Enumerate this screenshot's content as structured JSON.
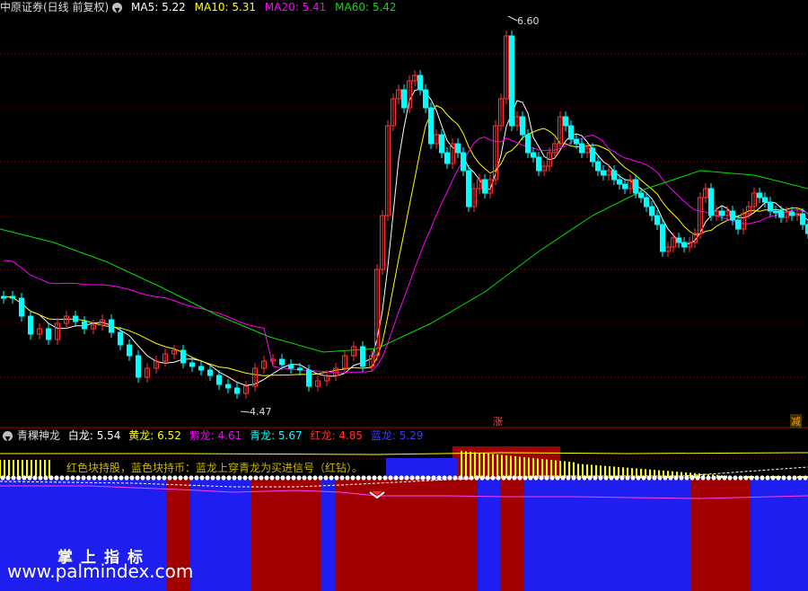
{
  "main_chart": {
    "title": "中原证券(日线 前复权)",
    "indicators": [
      {
        "label": "MA5: 5.22",
        "color": "#ffffff"
      },
      {
        "label": "MA10: 5.31",
        "color": "#ffff00"
      },
      {
        "label": "MA20: 5.41",
        "color": "#ff00ff"
      },
      {
        "label": "MA60: 5.42",
        "color": "#00e000"
      }
    ],
    "high_label": "6.60",
    "low_label": "4.47",
    "markers": {
      "zhang": "涨",
      "jian": "减"
    }
  },
  "sub_chart": {
    "title": "青稞神龙",
    "values": [
      {
        "label": "白龙: 5.54",
        "color": "#ffffff"
      },
      {
        "label": "黄龙: 6.52",
        "color": "#ffff00"
      },
      {
        "label": "紫龙: 4.61",
        "color": "#ff00ff"
      },
      {
        "label": "青龙: 5.67",
        "color": "#00ffff"
      },
      {
        "label": "红龙: 4.85",
        "color": "#ff3030"
      },
      {
        "label": "蓝龙: 5.29",
        "color": "#3a3aff"
      }
    ],
    "note": "红色块持股，蓝色块持币：蓝龙上穿青龙为买进信号（红钻）。"
  },
  "watermark": {
    "cn": "掌上指标",
    "url": "www.palmindex.com"
  },
  "colors": {
    "up": "#ff3232",
    "down": "#00ffff",
    "hold_block": "#a00000",
    "cash_block": "#1e1ef0",
    "grid": "#8b0000"
  }
}
